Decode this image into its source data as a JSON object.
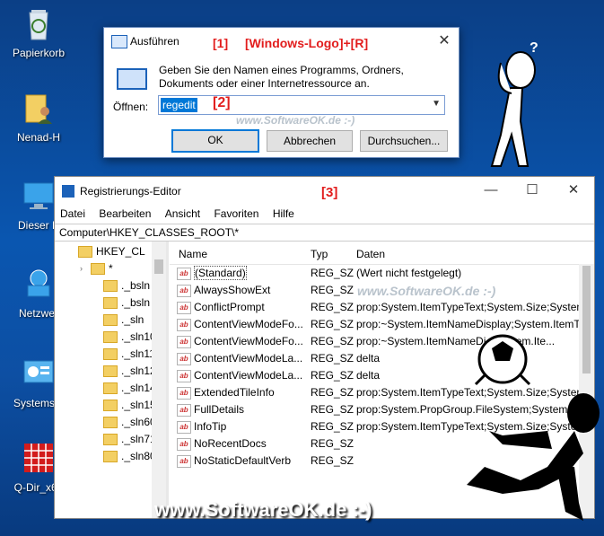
{
  "desktop": {
    "icons": [
      {
        "label": "Papierkorb"
      },
      {
        "label": "Nenad-H"
      },
      {
        "label": "Dieser P"
      },
      {
        "label": "Netzwer"
      },
      {
        "label": "Systemste"
      },
      {
        "label": "Q-Dir_x64"
      }
    ]
  },
  "run_dialog": {
    "title": "Ausführen",
    "close": "✕",
    "prompt": "Geben Sie den Namen eines Programms, Ordners, Dokuments oder einer Internetressource an.",
    "open_label": "Öffnen:",
    "open_value": "regedit",
    "ok": "OK",
    "cancel": "Abbrechen",
    "browse": "Durchsuchen..."
  },
  "annotations": {
    "step1": "[1]",
    "shortcut": "[Windows-Logo]+[R]",
    "step2": "[2]",
    "step3": "[3]",
    "watermark_small": "www.SoftwareOK.de :-)",
    "watermark_footer": "www.SoftwareOK.de :-)"
  },
  "regedit": {
    "title": "Registrierungs-Editor",
    "minimize": "—",
    "maximize": "☐",
    "close": "✕",
    "menu": [
      "Datei",
      "Bearbeiten",
      "Ansicht",
      "Favoriten",
      "Hilfe"
    ],
    "address": "Computer\\HKEY_CLASSES_ROOT\\*",
    "tree": [
      {
        "label": "HKEY_CL",
        "level": 0
      },
      {
        "label": "*",
        "level": 1
      },
      {
        "label": "._bsln",
        "level": 2
      },
      {
        "label": "._bsln",
        "level": 2
      },
      {
        "label": "._sln",
        "level": 2
      },
      {
        "label": "._sln10",
        "level": 2
      },
      {
        "label": "._sln11",
        "level": 2
      },
      {
        "label": "._sln12",
        "level": 2
      },
      {
        "label": "._sln14",
        "level": 2
      },
      {
        "label": "._sln15",
        "level": 2
      },
      {
        "label": "._sln60",
        "level": 2
      },
      {
        "label": "._sln71",
        "level": 2
      },
      {
        "label": "._sln80",
        "level": 2
      }
    ],
    "columns": {
      "name": "Name",
      "type": "Typ",
      "data": "Daten"
    },
    "values": [
      {
        "name": "(Standard)",
        "type": "REG_SZ",
        "data": "(Wert nicht festgelegt)"
      },
      {
        "name": "AlwaysShowExt",
        "type": "REG_SZ",
        "data": ""
      },
      {
        "name": "ConflictPrompt",
        "type": "REG_SZ",
        "data": "prop:System.ItemTypeText;System.Size;System."
      },
      {
        "name": "ContentViewModeFo...",
        "type": "REG_SZ",
        "data": "prop:~System.ItemNameDisplay;System.ItemT"
      },
      {
        "name": "ContentViewModeFo...",
        "type": "REG_SZ",
        "data": "prop:~System.ItemNameDi...System.Ite..."
      },
      {
        "name": "ContentViewModeLa...",
        "type": "REG_SZ",
        "data": "delta"
      },
      {
        "name": "ContentViewModeLa...",
        "type": "REG_SZ",
        "data": "delta"
      },
      {
        "name": "ExtendedTileInfo",
        "type": "REG_SZ",
        "data": "prop:System.ItemTypeText;System.Size;System."
      },
      {
        "name": "FullDetails",
        "type": "REG_SZ",
        "data": "prop:System.PropGroup.FileSystem;System.I"
      },
      {
        "name": "InfoTip",
        "type": "REG_SZ",
        "data": "prop:System.ItemTypeText;System.Size;System"
      },
      {
        "name": "NoRecentDocs",
        "type": "REG_SZ",
        "data": ""
      },
      {
        "name": "NoStaticDefaultVerb",
        "type": "REG_SZ",
        "data": ""
      }
    ]
  }
}
